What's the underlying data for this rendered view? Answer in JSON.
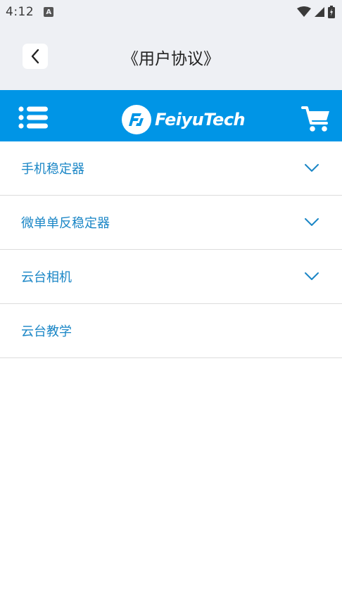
{
  "status_bar": {
    "time": "4:12",
    "notification_icon": "A"
  },
  "header": {
    "title": "《用户协议》",
    "back_icon": "chevron-left-icon"
  },
  "brand_bar": {
    "logo_text": "FeiyuTech",
    "menu_icon": "list-menu-icon",
    "cart_icon": "shopping-cart-icon",
    "background": "#0095e6"
  },
  "menu": {
    "items": [
      {
        "label": "手机稳定器",
        "expandable": true
      },
      {
        "label": "微单单反稳定器",
        "expandable": true
      },
      {
        "label": "云台相机",
        "expandable": true
      },
      {
        "label": "云台教学",
        "expandable": false
      }
    ]
  },
  "colors": {
    "accent": "#0095e6",
    "item_text": "#1a86c6",
    "header_bg": "#eef0f4"
  }
}
